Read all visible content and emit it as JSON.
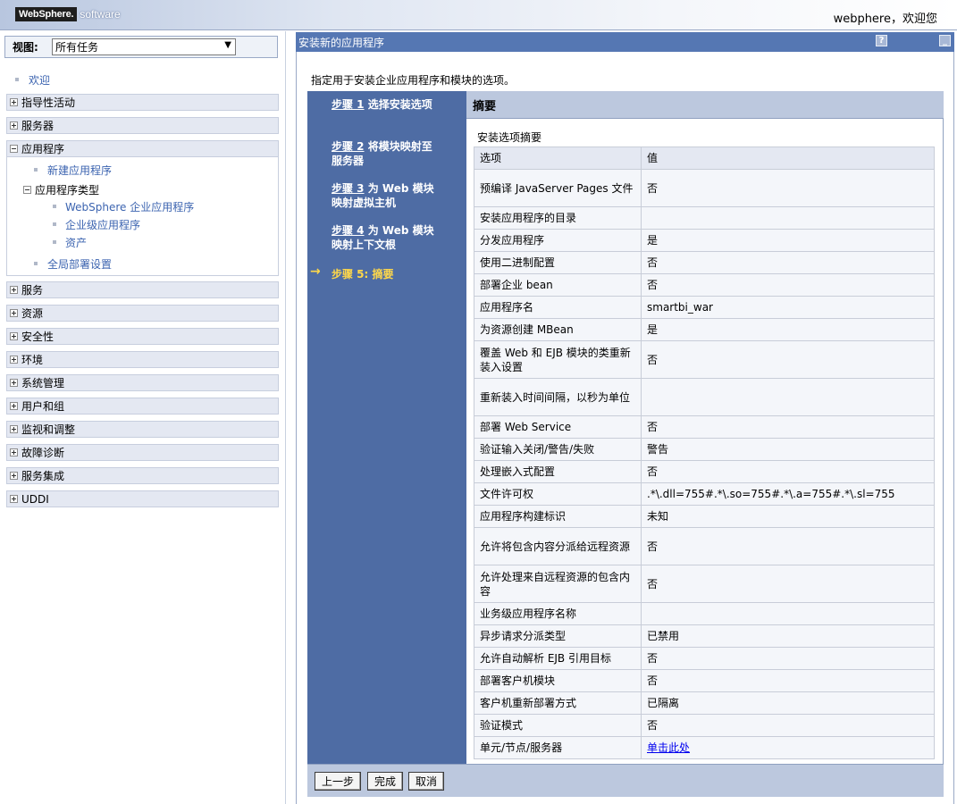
{
  "banner": {
    "logo": "WebSphere.",
    "logo_sub": "software",
    "welcome": "webphere，欢迎您"
  },
  "view": {
    "label": "视图:",
    "selected": "所有任务"
  },
  "nav": {
    "welcome": "欢迎",
    "sections_top": [
      "指导性活动",
      "服务器"
    ],
    "apps": {
      "label": "应用程序",
      "new_app": "新建应用程序",
      "types_label": "应用程序类型",
      "types": [
        "WebSphere 企业应用程序",
        "企业级应用程序",
        "资产"
      ],
      "global_deploy": "全局部署设置"
    },
    "sections_bottom": [
      "服务",
      "资源",
      "安全性",
      "环境",
      "系统管理",
      "用户和组",
      "监视和调整",
      "故障诊断",
      "服务集成",
      "UDDI"
    ]
  },
  "main": {
    "title": "安装新的应用程序",
    "help_icon_glyph": "?",
    "minimize_glyph": "_",
    "intro": "指定用于安装企业应用程序和模块的选项。"
  },
  "steps": [
    {
      "prefix": "步骤 1",
      "text": " 选择安装选项"
    },
    {
      "prefix": "步骤 2",
      "text": " 将模块映射至服务器"
    },
    {
      "prefix": "步骤 3",
      "text": " 为 Web 模块映射虚拟主机"
    },
    {
      "prefix": "步骤 4",
      "text": " 为 Web 模块映射上下文根"
    },
    {
      "prefix": "步骤 5: 摘要",
      "text": ""
    }
  ],
  "summary": {
    "heading": "摘要",
    "subtitle": "安装选项摘要",
    "col_option": "选项",
    "col_value": "值",
    "rows": [
      {
        "option": "预编译 JavaServer Pages 文件",
        "value": "否"
      },
      {
        "option": "安装应用程序的目录",
        "value": ""
      },
      {
        "option": "分发应用程序",
        "value": "是"
      },
      {
        "option": "使用二进制配置",
        "value": "否"
      },
      {
        "option": "部署企业 bean",
        "value": "否"
      },
      {
        "option": "应用程序名",
        "value": "smartbi_war"
      },
      {
        "option": "为资源创建 MBean",
        "value": "是"
      },
      {
        "option": "覆盖 Web 和 EJB 模块的类重新装入设置",
        "value": "否"
      },
      {
        "option": "重新装入时间间隔，以秒为单位",
        "value": ""
      },
      {
        "option": "部署 Web Service",
        "value": "否"
      },
      {
        "option": "验证输入关闭/警告/失败",
        "value": "警告"
      },
      {
        "option": "处理嵌入式配置",
        "value": "否"
      },
      {
        "option": "文件许可权",
        "value": ".*\\.dll=755#.*\\.so=755#.*\\.a=755#.*\\.sl=755"
      },
      {
        "option": "应用程序构建标识",
        "value": "未知"
      },
      {
        "option": "允许将包含内容分派给远程资源",
        "value": "否"
      },
      {
        "option": "允许处理来自远程资源的包含内容",
        "value": "否"
      },
      {
        "option": "业务级应用程序名称",
        "value": ""
      },
      {
        "option": "异步请求分派类型",
        "value": "已禁用"
      },
      {
        "option": "允许自动解析 EJB 引用目标",
        "value": "否"
      },
      {
        "option": "部署客户机模块",
        "value": "否"
      },
      {
        "option": "客户机重新部署方式",
        "value": "已隔离"
      },
      {
        "option": "验证模式",
        "value": "否"
      },
      {
        "option": "单元/节点/服务器",
        "value": "单击此处"
      }
    ]
  },
  "buttons": {
    "prev": "上一步",
    "finish": "完成",
    "cancel": "取消"
  }
}
